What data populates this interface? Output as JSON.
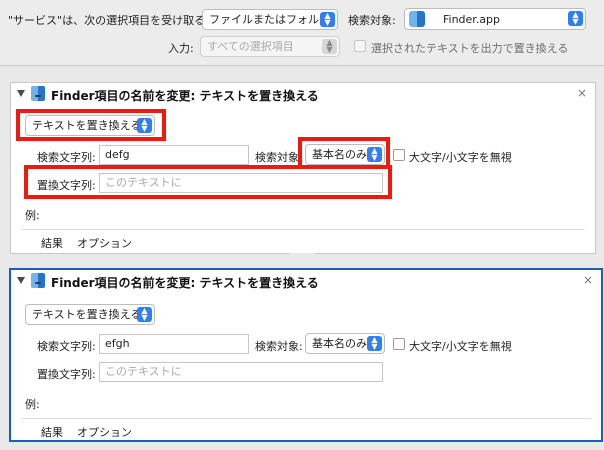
{
  "topbar": {
    "service_receives_label": "\"サービス\"は、次の選択項目を受け取る:",
    "input_type_value": "ファイルまたはフォルダ",
    "search_target_label": "検索対象:",
    "app_value": "Finder.app",
    "input_label": "入力:",
    "input_value": "すべての選択項目",
    "output_replace_label": "選択されたテキストを出力で置き換える"
  },
  "panels": [
    {
      "title": "Finder項目の名前を変更: テキストを置き換える",
      "mode_value": "テキストを置き換える",
      "find_label": "検索文字列:",
      "find_value": "defg",
      "search_in_label": "検索対象:",
      "search_in_value": "基本名のみ",
      "ignore_case_label": "大文字/小文字を無視",
      "replace_label": "置換文字列:",
      "replace_placeholder": "このテキストに",
      "example_label": "例:",
      "tab_results": "結果",
      "tab_options": "オプション",
      "close": "×"
    },
    {
      "title": "Finder項目の名前を変更: テキストを置き換える",
      "mode_value": "テキストを置き換える",
      "find_label": "検索文字列:",
      "find_value": "efgh",
      "search_in_label": "検索対象:",
      "search_in_value": "基本名のみ",
      "ignore_case_label": "大文字/小文字を無視",
      "replace_label": "置換文字列:",
      "replace_placeholder": "このテキストに",
      "example_label": "例:",
      "tab_results": "結果",
      "tab_options": "オプション",
      "close": "×"
    }
  ],
  "colors": {
    "highlight": "#ef1a0e",
    "selected_border": "#1a5fc0",
    "accent": "#2f7ef6"
  }
}
